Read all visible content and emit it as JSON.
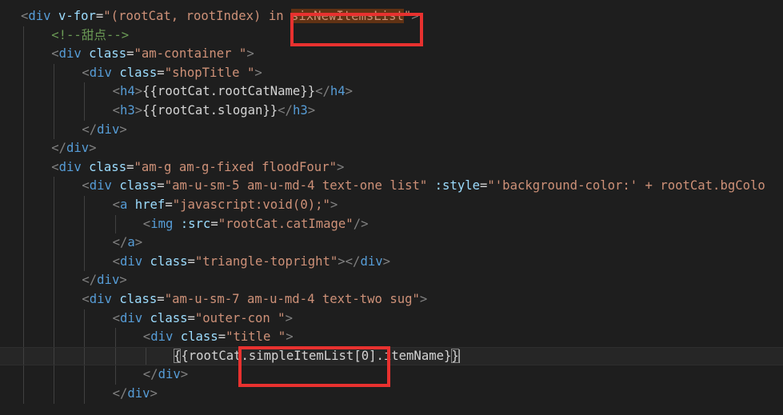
{
  "editor": {
    "lines": [
      {
        "tokens": [
          {
            "c": "t-punct",
            "t": "<"
          },
          {
            "c": "t-tag",
            "t": "div"
          },
          {
            "c": "t-txt",
            "t": " "
          },
          {
            "c": "t-attr",
            "t": "v-for"
          },
          {
            "c": "t-txt",
            "t": "="
          },
          {
            "c": "t-str",
            "t": "\"(rootCat, rootIndex) in "
          },
          {
            "c": "t-str hl-sel",
            "t": "sixNewItemsList"
          },
          {
            "c": "t-str",
            "t": "\""
          },
          {
            "c": "t-punct",
            "t": ">"
          }
        ]
      },
      {
        "tokens": [
          {
            "c": "t-cmt",
            "t": "<!--甜点-->"
          }
        ]
      },
      {
        "tokens": [
          {
            "c": "t-punct",
            "t": "<"
          },
          {
            "c": "t-tag",
            "t": "div"
          },
          {
            "c": "t-txt",
            "t": " "
          },
          {
            "c": "t-attr",
            "t": "class"
          },
          {
            "c": "t-txt",
            "t": "="
          },
          {
            "c": "t-str",
            "t": "\"am-container \""
          },
          {
            "c": "t-punct",
            "t": ">"
          }
        ]
      },
      {
        "tokens": [
          {
            "c": "t-punct",
            "t": "<"
          },
          {
            "c": "t-tag",
            "t": "div"
          },
          {
            "c": "t-txt",
            "t": " "
          },
          {
            "c": "t-attr",
            "t": "class"
          },
          {
            "c": "t-txt",
            "t": "="
          },
          {
            "c": "t-str",
            "t": "\"shopTitle \""
          },
          {
            "c": "t-punct",
            "t": ">"
          }
        ]
      },
      {
        "tokens": [
          {
            "c": "t-punct",
            "t": "<"
          },
          {
            "c": "t-tag",
            "t": "h4"
          },
          {
            "c": "t-punct",
            "t": ">"
          },
          {
            "c": "t-txt",
            "t": "{{rootCat.rootCatName}}"
          },
          {
            "c": "t-punct",
            "t": "</"
          },
          {
            "c": "t-tag",
            "t": "h4"
          },
          {
            "c": "t-punct",
            "t": ">"
          }
        ]
      },
      {
        "tokens": [
          {
            "c": "t-punct",
            "t": "<"
          },
          {
            "c": "t-tag",
            "t": "h3"
          },
          {
            "c": "t-punct",
            "t": ">"
          },
          {
            "c": "t-txt",
            "t": "{{rootCat.slogan}}"
          },
          {
            "c": "t-punct",
            "t": "</"
          },
          {
            "c": "t-tag",
            "t": "h3"
          },
          {
            "c": "t-punct",
            "t": ">"
          }
        ]
      },
      {
        "tokens": [
          {
            "c": "t-punct",
            "t": "</"
          },
          {
            "c": "t-tag",
            "t": "div"
          },
          {
            "c": "t-punct",
            "t": ">"
          }
        ]
      },
      {
        "tokens": [
          {
            "c": "t-punct",
            "t": "</"
          },
          {
            "c": "t-tag",
            "t": "div"
          },
          {
            "c": "t-punct",
            "t": ">"
          }
        ]
      },
      {
        "tokens": [
          {
            "c": "t-punct",
            "t": "<"
          },
          {
            "c": "t-tag",
            "t": "div"
          },
          {
            "c": "t-txt",
            "t": " "
          },
          {
            "c": "t-attr",
            "t": "class"
          },
          {
            "c": "t-txt",
            "t": "="
          },
          {
            "c": "t-str",
            "t": "\"am-g am-g-fixed floodFour\""
          },
          {
            "c": "t-punct",
            "t": ">"
          }
        ]
      },
      {
        "tokens": [
          {
            "c": "t-punct",
            "t": "<"
          },
          {
            "c": "t-tag",
            "t": "div"
          },
          {
            "c": "t-txt",
            "t": " "
          },
          {
            "c": "t-attr",
            "t": "class"
          },
          {
            "c": "t-txt",
            "t": "="
          },
          {
            "c": "t-str",
            "t": "\"am-u-sm-5 am-u-md-4 text-one list\""
          },
          {
            "c": "t-txt",
            "t": " "
          },
          {
            "c": "t-attr",
            "t": ":style"
          },
          {
            "c": "t-txt",
            "t": "="
          },
          {
            "c": "t-str",
            "t": "\"'background-color:' + rootCat.bgColo"
          }
        ]
      },
      {
        "tokens": [
          {
            "c": "t-punct",
            "t": "<"
          },
          {
            "c": "t-tag",
            "t": "a"
          },
          {
            "c": "t-txt",
            "t": " "
          },
          {
            "c": "t-attr",
            "t": "href"
          },
          {
            "c": "t-txt",
            "t": "="
          },
          {
            "c": "t-str",
            "t": "\"javascript:void(0);\""
          },
          {
            "c": "t-punct",
            "t": ">"
          }
        ]
      },
      {
        "tokens": [
          {
            "c": "t-punct",
            "t": "<"
          },
          {
            "c": "t-tag",
            "t": "img"
          },
          {
            "c": "t-txt",
            "t": " "
          },
          {
            "c": "t-attr",
            "t": ":src"
          },
          {
            "c": "t-txt",
            "t": "="
          },
          {
            "c": "t-str",
            "t": "\"rootCat.catImage\""
          },
          {
            "c": "t-punct",
            "t": "/>"
          }
        ]
      },
      {
        "tokens": [
          {
            "c": "t-punct",
            "t": "</"
          },
          {
            "c": "t-tag",
            "t": "a"
          },
          {
            "c": "t-punct",
            "t": ">"
          }
        ]
      },
      {
        "tokens": [
          {
            "c": "t-punct",
            "t": "<"
          },
          {
            "c": "t-tag",
            "t": "div"
          },
          {
            "c": "t-txt",
            "t": " "
          },
          {
            "c": "t-attr",
            "t": "class"
          },
          {
            "c": "t-txt",
            "t": "="
          },
          {
            "c": "t-str",
            "t": "\"triangle-topright\""
          },
          {
            "c": "t-punct",
            "t": "></"
          },
          {
            "c": "t-tag",
            "t": "div"
          },
          {
            "c": "t-punct",
            "t": ">"
          }
        ]
      },
      {
        "tokens": [
          {
            "c": "t-punct",
            "t": "</"
          },
          {
            "c": "t-tag",
            "t": "div"
          },
          {
            "c": "t-punct",
            "t": ">"
          }
        ]
      },
      {
        "tokens": [
          {
            "c": "t-punct",
            "t": "<"
          },
          {
            "c": "t-tag",
            "t": "div"
          },
          {
            "c": "t-txt",
            "t": " "
          },
          {
            "c": "t-attr",
            "t": "class"
          },
          {
            "c": "t-txt",
            "t": "="
          },
          {
            "c": "t-str",
            "t": "\"am-u-sm-7 am-u-md-4 text-two sug\""
          },
          {
            "c": "t-punct",
            "t": ">"
          }
        ]
      },
      {
        "tokens": [
          {
            "c": "t-punct",
            "t": "<"
          },
          {
            "c": "t-tag",
            "t": "div"
          },
          {
            "c": "t-txt",
            "t": " "
          },
          {
            "c": "t-attr",
            "t": "class"
          },
          {
            "c": "t-txt",
            "t": "="
          },
          {
            "c": "t-str",
            "t": "\"outer-con \""
          },
          {
            "c": "t-punct",
            "t": ">"
          }
        ]
      },
      {
        "tokens": [
          {
            "c": "t-punct",
            "t": "<"
          },
          {
            "c": "t-tag",
            "t": "div"
          },
          {
            "c": "t-txt",
            "t": " "
          },
          {
            "c": "t-attr",
            "t": "class"
          },
          {
            "c": "t-txt",
            "t": "="
          },
          {
            "c": "t-str",
            "t": "\"title \""
          },
          {
            "c": "t-punct",
            "t": ">"
          }
        ]
      },
      {
        "tokens": [
          {
            "c": "t-txt bracket",
            "t": "{"
          },
          {
            "c": "t-txt",
            "t": "{rootCat.simpleItemList[0].itemName}"
          },
          {
            "c": "t-txt bracket",
            "t": "}"
          },
          {
            "c": "caret",
            "t": ""
          }
        ]
      },
      {
        "tokens": [
          {
            "c": "t-punct",
            "t": "</"
          },
          {
            "c": "t-tag",
            "t": "div"
          },
          {
            "c": "t-punct",
            "t": ">"
          }
        ]
      },
      {
        "tokens": [
          {
            "c": "t-punct",
            "t": "</"
          },
          {
            "c": "t-tag",
            "t": "div"
          },
          {
            "c": "t-punct",
            "t": ">"
          }
        ]
      }
    ]
  }
}
